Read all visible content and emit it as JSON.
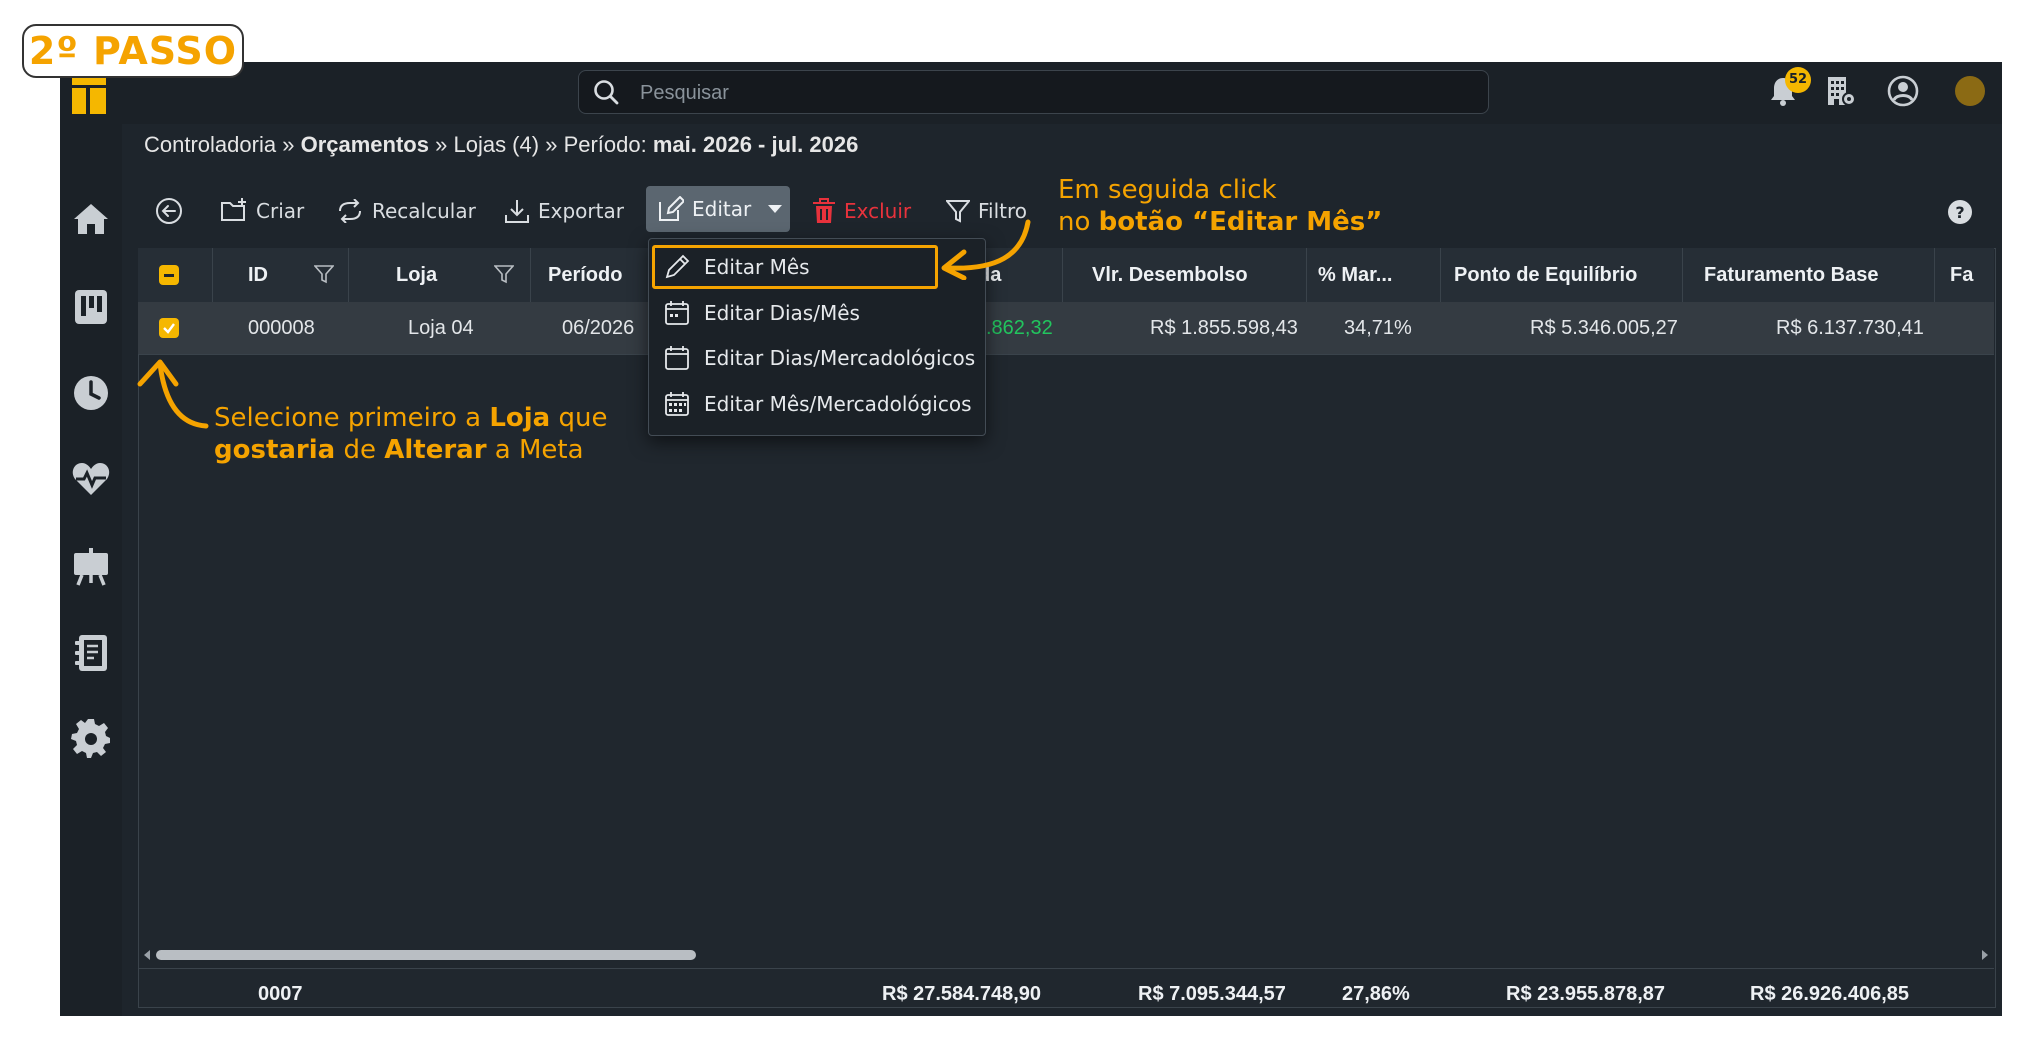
{
  "step_badge": "2º PASSO",
  "search": {
    "placeholder": "Pesquisar"
  },
  "notifications": {
    "count": "52"
  },
  "breadcrumb": {
    "part1": "Controladoria",
    "sep": "»",
    "part2": "Orçamentos",
    "part3": "Lojas (4)",
    "part4_label": "Período:",
    "part4_value": "mai. 2026 - jul. 2026"
  },
  "toolbar": {
    "create": "Criar",
    "recalculate": "Recalcular",
    "export": "Exportar",
    "edit": "Editar",
    "delete": "Excluir",
    "filter": "Filtro"
  },
  "table": {
    "columns": [
      "ID",
      "Loja",
      "Período",
      "da",
      "Vlr. Desembolso",
      "% Mar...",
      "Ponto de Equilíbrio",
      "Faturamento Base",
      "Fa"
    ],
    "row": {
      "id": "000008",
      "loja": "Loja 04",
      "periodo": "06/2026",
      "partial_value": ".862,32",
      "desembolso": "R$ 1.855.598,43",
      "margem": "34,71%",
      "equilibrio": "R$ 5.346.005,27",
      "faturamento": "R$ 6.137.730,41"
    },
    "footer": {
      "count": "0007",
      "total1": "R$ 27.584.748,90",
      "total2": "R$ 7.095.344,57",
      "total3": "27,86%",
      "total4": "R$ 23.955.878,87",
      "total5": "R$ 26.926.406,85"
    }
  },
  "edit_menu": {
    "items": [
      "Editar Mês",
      "Editar Dias/Mês",
      "Editar Dias/Mercadológicos",
      "Editar Mês/Mercadológicos"
    ]
  },
  "annotations": {
    "top_line1": "Em seguida click",
    "top_line2_pre": "no ",
    "top_line2_bold": "botão “Editar Mês”",
    "left_line1_pre": "Selecione primeiro a ",
    "left_line1_bold": "Loja",
    "left_line1_post": " que",
    "left_line2_bold1": "gostaria",
    "left_line2_mid": " de ",
    "left_line2_bold2": "Alterar",
    "left_line2_post": " a Meta"
  },
  "colors": {
    "accent": "#f5a300",
    "danger": "#e8323c",
    "positive": "#22c55e",
    "background": "#1e252c"
  }
}
